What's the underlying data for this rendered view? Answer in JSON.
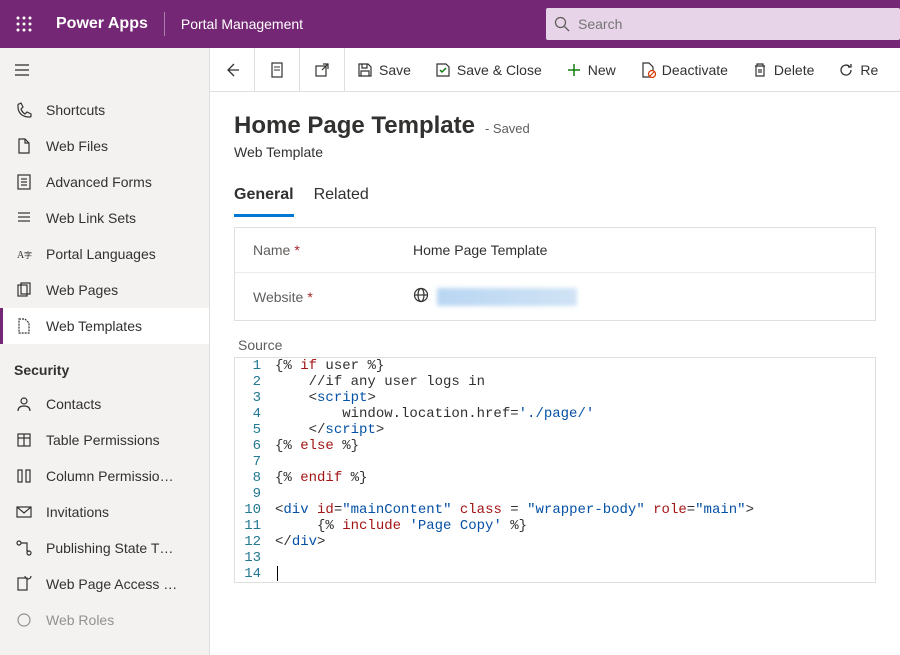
{
  "topbar": {
    "brand": "Power Apps",
    "subbrand": "Portal Management",
    "search_placeholder": "Search"
  },
  "sidebar": {
    "items_content": [
      {
        "label": "Shortcuts"
      },
      {
        "label": "Web Files"
      },
      {
        "label": "Advanced Forms"
      },
      {
        "label": "Web Link Sets"
      },
      {
        "label": "Portal Languages"
      },
      {
        "label": "Web Pages"
      },
      {
        "label": "Web Templates"
      }
    ],
    "section_security": "Security",
    "items_security": [
      {
        "label": "Contacts"
      },
      {
        "label": "Table Permissions"
      },
      {
        "label": "Column Permissio…"
      },
      {
        "label": "Invitations"
      },
      {
        "label": "Publishing State T…"
      },
      {
        "label": "Web Page Access …"
      },
      {
        "label": "Web Roles"
      }
    ]
  },
  "cmdbar": {
    "save": "Save",
    "save_close": "Save & Close",
    "new": "New",
    "deactivate": "Deactivate",
    "delete": "Delete",
    "refresh": "Re"
  },
  "header": {
    "title": "Home Page Template",
    "state": "- Saved",
    "subtitle": "Web Template"
  },
  "tabs": {
    "general": "General",
    "related": "Related"
  },
  "form": {
    "name_label": "Name",
    "name_value": "Home Page Template",
    "website_label": "Website",
    "source_label": "Source"
  },
  "code": {
    "lines": [
      "{% if user %}",
      "    //if any user logs in",
      "    <script>",
      "        window.location.href='./page/'",
      "    </script>",
      "{% else %}",
      "",
      "{% endif %}",
      "",
      "<div id=\"mainContent\" class = \"wrapper-body\" role=\"main\">",
      "     {% include 'Page Copy' %}",
      "</div>",
      "",
      ""
    ]
  }
}
